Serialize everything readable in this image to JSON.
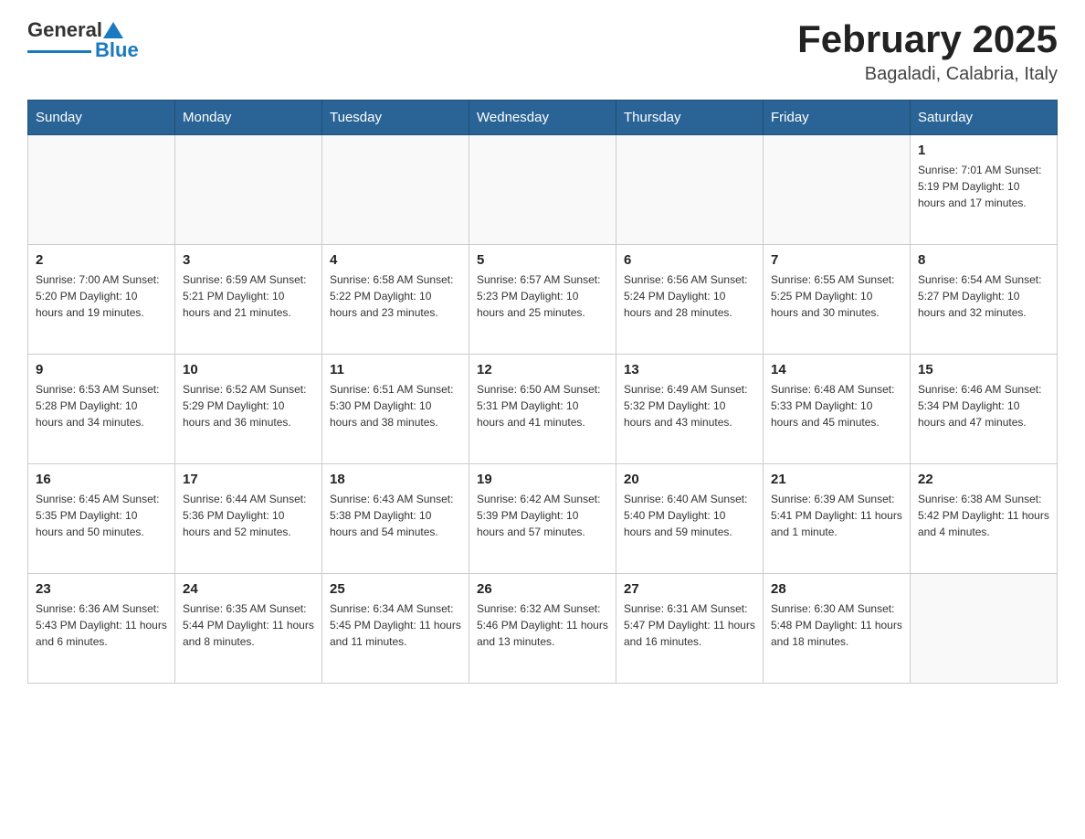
{
  "header": {
    "logo_general": "General",
    "logo_blue": "Blue",
    "month_title": "February 2025",
    "location": "Bagaladi, Calabria, Italy"
  },
  "days_of_week": [
    "Sunday",
    "Monday",
    "Tuesday",
    "Wednesday",
    "Thursday",
    "Friday",
    "Saturday"
  ],
  "weeks": [
    [
      {
        "day": "",
        "info": ""
      },
      {
        "day": "",
        "info": ""
      },
      {
        "day": "",
        "info": ""
      },
      {
        "day": "",
        "info": ""
      },
      {
        "day": "",
        "info": ""
      },
      {
        "day": "",
        "info": ""
      },
      {
        "day": "1",
        "info": "Sunrise: 7:01 AM\nSunset: 5:19 PM\nDaylight: 10 hours and 17 minutes."
      }
    ],
    [
      {
        "day": "2",
        "info": "Sunrise: 7:00 AM\nSunset: 5:20 PM\nDaylight: 10 hours and 19 minutes."
      },
      {
        "day": "3",
        "info": "Sunrise: 6:59 AM\nSunset: 5:21 PM\nDaylight: 10 hours and 21 minutes."
      },
      {
        "day": "4",
        "info": "Sunrise: 6:58 AM\nSunset: 5:22 PM\nDaylight: 10 hours and 23 minutes."
      },
      {
        "day": "5",
        "info": "Sunrise: 6:57 AM\nSunset: 5:23 PM\nDaylight: 10 hours and 25 minutes."
      },
      {
        "day": "6",
        "info": "Sunrise: 6:56 AM\nSunset: 5:24 PM\nDaylight: 10 hours and 28 minutes."
      },
      {
        "day": "7",
        "info": "Sunrise: 6:55 AM\nSunset: 5:25 PM\nDaylight: 10 hours and 30 minutes."
      },
      {
        "day": "8",
        "info": "Sunrise: 6:54 AM\nSunset: 5:27 PM\nDaylight: 10 hours and 32 minutes."
      }
    ],
    [
      {
        "day": "9",
        "info": "Sunrise: 6:53 AM\nSunset: 5:28 PM\nDaylight: 10 hours and 34 minutes."
      },
      {
        "day": "10",
        "info": "Sunrise: 6:52 AM\nSunset: 5:29 PM\nDaylight: 10 hours and 36 minutes."
      },
      {
        "day": "11",
        "info": "Sunrise: 6:51 AM\nSunset: 5:30 PM\nDaylight: 10 hours and 38 minutes."
      },
      {
        "day": "12",
        "info": "Sunrise: 6:50 AM\nSunset: 5:31 PM\nDaylight: 10 hours and 41 minutes."
      },
      {
        "day": "13",
        "info": "Sunrise: 6:49 AM\nSunset: 5:32 PM\nDaylight: 10 hours and 43 minutes."
      },
      {
        "day": "14",
        "info": "Sunrise: 6:48 AM\nSunset: 5:33 PM\nDaylight: 10 hours and 45 minutes."
      },
      {
        "day": "15",
        "info": "Sunrise: 6:46 AM\nSunset: 5:34 PM\nDaylight: 10 hours and 47 minutes."
      }
    ],
    [
      {
        "day": "16",
        "info": "Sunrise: 6:45 AM\nSunset: 5:35 PM\nDaylight: 10 hours and 50 minutes."
      },
      {
        "day": "17",
        "info": "Sunrise: 6:44 AM\nSunset: 5:36 PM\nDaylight: 10 hours and 52 minutes."
      },
      {
        "day": "18",
        "info": "Sunrise: 6:43 AM\nSunset: 5:38 PM\nDaylight: 10 hours and 54 minutes."
      },
      {
        "day": "19",
        "info": "Sunrise: 6:42 AM\nSunset: 5:39 PM\nDaylight: 10 hours and 57 minutes."
      },
      {
        "day": "20",
        "info": "Sunrise: 6:40 AM\nSunset: 5:40 PM\nDaylight: 10 hours and 59 minutes."
      },
      {
        "day": "21",
        "info": "Sunrise: 6:39 AM\nSunset: 5:41 PM\nDaylight: 11 hours and 1 minute."
      },
      {
        "day": "22",
        "info": "Sunrise: 6:38 AM\nSunset: 5:42 PM\nDaylight: 11 hours and 4 minutes."
      }
    ],
    [
      {
        "day": "23",
        "info": "Sunrise: 6:36 AM\nSunset: 5:43 PM\nDaylight: 11 hours and 6 minutes."
      },
      {
        "day": "24",
        "info": "Sunrise: 6:35 AM\nSunset: 5:44 PM\nDaylight: 11 hours and 8 minutes."
      },
      {
        "day": "25",
        "info": "Sunrise: 6:34 AM\nSunset: 5:45 PM\nDaylight: 11 hours and 11 minutes."
      },
      {
        "day": "26",
        "info": "Sunrise: 6:32 AM\nSunset: 5:46 PM\nDaylight: 11 hours and 13 minutes."
      },
      {
        "day": "27",
        "info": "Sunrise: 6:31 AM\nSunset: 5:47 PM\nDaylight: 11 hours and 16 minutes."
      },
      {
        "day": "28",
        "info": "Sunrise: 6:30 AM\nSunset: 5:48 PM\nDaylight: 11 hours and 18 minutes."
      },
      {
        "day": "",
        "info": ""
      }
    ]
  ]
}
